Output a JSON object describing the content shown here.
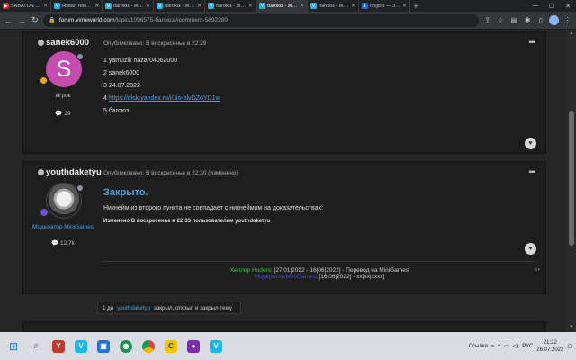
{
  "browser": {
    "tabs": [
      {
        "title": "SABATON - Не...",
        "fav": "#e02020",
        "fav_icon": "▶",
        "active": false
      },
      {
        "title": "Новая тема - V...",
        "fav": "#1ab7ea",
        "fav_icon": "V",
        "active": false
      },
      {
        "title": "багоюз - Жал...",
        "fav": "#1ab7ea",
        "fav_icon": "V",
        "active": false
      },
      {
        "title": "багоюз - Жал...",
        "fav": "#1ab7ea",
        "fav_icon": "V",
        "active": false
      },
      {
        "title": "багоюз - Жал...",
        "fav": "#1ab7ea",
        "fav_icon": "V",
        "active": false
      },
      {
        "title": "багоюз - Жал...",
        "fav": "#1ab7ea",
        "fav_icon": "V",
        "active": true
      },
      {
        "title": "багоюз - Жал...",
        "fav": "#1ab7ea",
        "fav_icon": "V",
        "active": false
      },
      {
        "title": "ImgBB — Загр...",
        "fav": "#2b6bd8",
        "fav_icon": "I",
        "active": false
      }
    ],
    "url_host": "forum.vimeworld.com",
    "url_path": "/topic/1096575-багоюз/#comment-5892280"
  },
  "posts": [
    {
      "author": "sanek6000",
      "posted": "Опубликовано: В воскресенье в 22:29",
      "avatar_letter": "S",
      "rank": "Игрок",
      "reputation": "29",
      "lines": [
        "1 yamuzik nazar04062000",
        "2 sanek6000",
        "3 24.07.2022"
      ],
      "line4_prefix": "4 ",
      "link": "https://disk.yandex.ru/i/Jin-alvDZoYD1w",
      "line5": "5 багоюз"
    },
    {
      "author": "youthdaketyu",
      "posted": "Опубликовано: В воскресенье в 22:30 (изменено)",
      "rank": "Модератор MiniGames",
      "reputation": "12,7k",
      "heading": "Закрыто.",
      "body": "Никнейм из второго пункта не совпадает с никнеймом на доказательствах.",
      "edited_note": "Изменено В воскресенье в 22:33 пользователем youthdaketyu",
      "sig_role1": "Хелпер Hoders",
      "sig_text1": ": [27|01|2022 - 16|06|2022] - Перевод на MiniGames",
      "sig_role2": "Модератор MiniGames",
      "sig_text2": ": [16|06|2022] - xx|xx|xxxx]"
    }
  ],
  "event": {
    "time": "1 дн",
    "user": "youthdaketyu",
    "text": "закрыл, открыл и закрыл тему"
  },
  "taskbar": {
    "tray_label": "Ссылки",
    "lang": "РУС",
    "time": "21:22",
    "date": "26.07.2022"
  }
}
